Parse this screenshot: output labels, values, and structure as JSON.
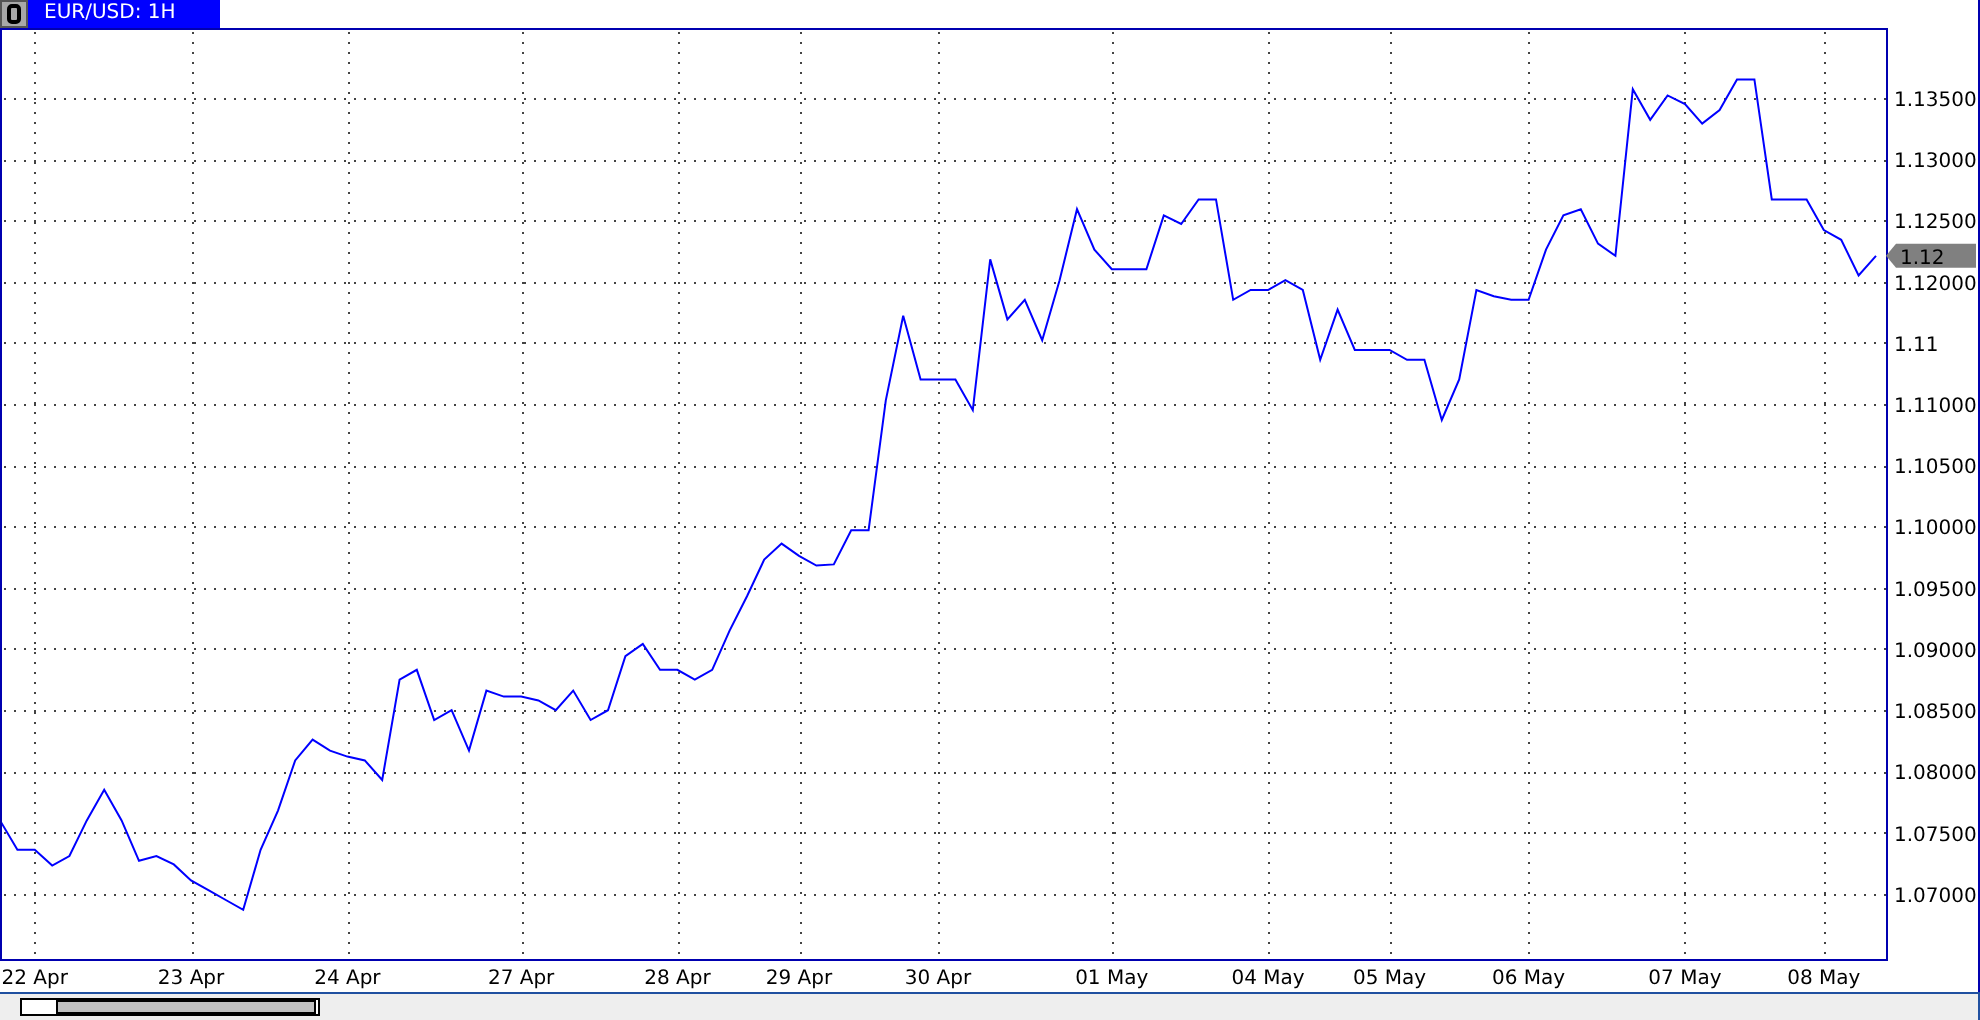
{
  "window": {
    "title": "EUR/USD: 1H"
  },
  "chart": {
    "price_marker": "1.12",
    "chart_data": {
      "type": "line",
      "categories": [
        null,
        null,
        "22 Apr",
        null,
        null,
        null,
        null,
        null,
        null,
        null,
        null,
        "23 Apr",
        null,
        null,
        null,
        null,
        null,
        null,
        null,
        null,
        "24 Apr",
        null,
        null,
        null,
        null,
        null,
        null,
        null,
        null,
        null,
        "27 Apr",
        null,
        null,
        null,
        null,
        null,
        null,
        null,
        null,
        "28 Apr",
        null,
        null,
        null,
        null,
        null,
        null,
        "29 Apr",
        null,
        null,
        null,
        null,
        null,
        null,
        null,
        "30 Apr",
        null,
        null,
        null,
        null,
        null,
        null,
        null,
        null,
        null,
        "01 May",
        null,
        null,
        null,
        null,
        null,
        null,
        null,
        null,
        "04 May",
        null,
        null,
        null,
        null,
        null,
        null,
        "05 May",
        null,
        null,
        null,
        null,
        null,
        null,
        null,
        "06 May",
        null,
        null,
        null,
        null,
        null,
        null,
        null,
        null,
        "07 May",
        null,
        null,
        null,
        null,
        null,
        null,
        null,
        "08 May",
        null,
        null,
        null
      ],
      "values": [
        1.076,
        1.0736,
        1.0736,
        1.0723,
        1.0731,
        1.076,
        1.0785,
        1.076,
        1.0727,
        1.0731,
        1.0724,
        1.0711,
        1.0703,
        1.0695,
        1.0687,
        1.0736,
        1.0768,
        1.0809,
        1.0826,
        1.0817,
        1.0812,
        1.0809,
        1.0793,
        1.0875,
        1.0883,
        1.0842,
        1.085,
        1.0817,
        1.0866,
        1.0861,
        1.0861,
        1.0858,
        1.085,
        1.0866,
        1.0842,
        1.085,
        1.0894,
        1.0904,
        1.0883,
        1.0883,
        1.0875,
        1.0883,
        1.0915,
        1.0943,
        1.0973,
        1.0986,
        1.0976,
        1.0968,
        1.0969,
        1.0997,
        1.0997,
        1.1103,
        1.1172,
        1.112,
        1.112,
        1.112,
        1.1095,
        1.1218,
        1.1169,
        1.1185,
        1.1152,
        1.1201,
        1.1259,
        1.1226,
        1.121,
        1.121,
        1.121,
        1.1254,
        1.1247,
        1.1267,
        1.1267,
        1.1185,
        1.1193,
        1.1193,
        1.1201,
        1.1193,
        1.1136,
        1.1177,
        1.1144,
        1.1144,
        1.1144,
        1.1136,
        1.1136,
        1.1087,
        1.112,
        1.1193,
        1.1188,
        1.1185,
        1.1185,
        1.1226,
        1.1254,
        1.1259,
        1.1231,
        1.1221,
        1.1357,
        1.1332,
        1.1352,
        1.1345,
        1.1329,
        1.134,
        1.1365,
        1.1365,
        1.1267,
        1.1267,
        1.1267,
        1.1242,
        1.1234,
        1.1205,
        1.1221
      ],
      "ylim": [
        1.0646,
        1.1407
      ],
      "grid": true,
      "yticks": [
        {
          "value": 1.07,
          "label": "1.07000"
        },
        {
          "value": 1.075,
          "label": "1.07500"
        },
        {
          "value": 1.08,
          "label": "1.08000"
        },
        {
          "value": 1.085,
          "label": "1.08500"
        },
        {
          "value": 1.09,
          "label": "1.09000"
        },
        {
          "value": 1.095,
          "label": "1.09500"
        },
        {
          "value": 1.1,
          "label": "1.10000"
        },
        {
          "value": 1.105,
          "label": "1.10500"
        },
        {
          "value": 1.11,
          "label": "1.11000"
        },
        {
          "value": 1.115,
          "label": "1.11"
        },
        {
          "value": 1.12,
          "label": "1.12000"
        },
        {
          "value": 1.125,
          "label": "1.12500"
        },
        {
          "value": 1.13,
          "label": "1.13000"
        },
        {
          "value": 1.135,
          "label": "1.13500"
        }
      ]
    }
  }
}
